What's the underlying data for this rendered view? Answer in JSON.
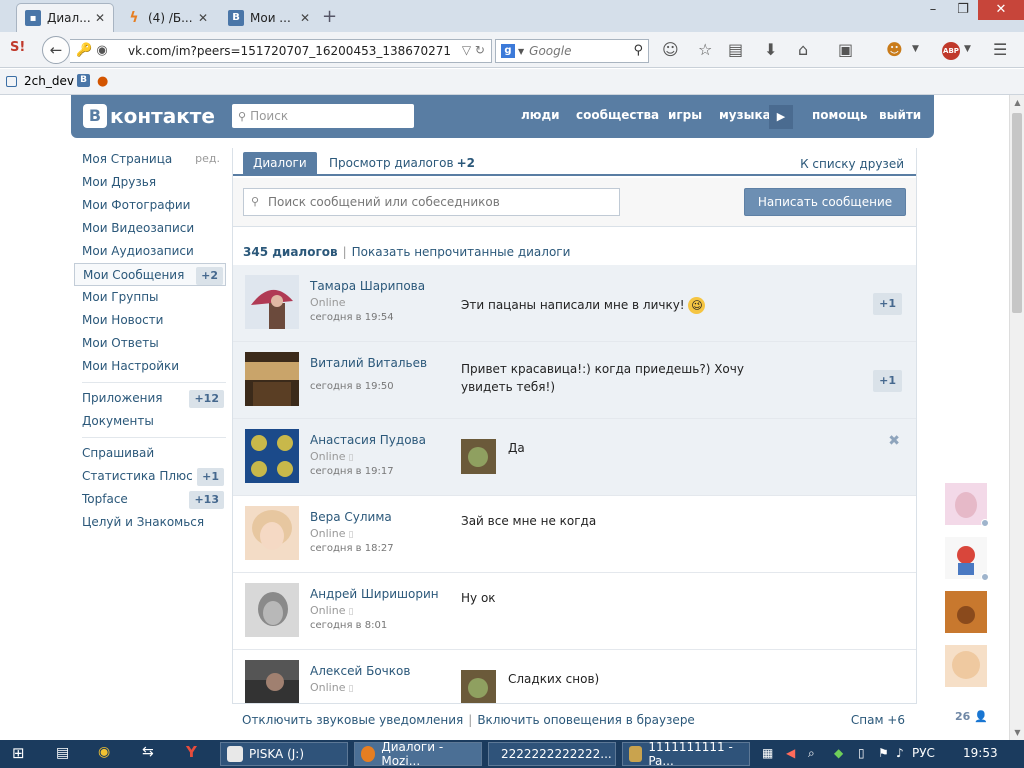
{
  "browser": {
    "tabs": [
      {
        "label": "Диал...",
        "color": "#4a76a8"
      },
      {
        "label": "(4) /Б...",
        "color": "#e67e22"
      },
      {
        "label": "Мои ...",
        "color": "#4a76a8"
      }
    ],
    "new_tab": "+",
    "window_controls": {
      "minimize": "–",
      "restore": "❐",
      "close": "✕"
    },
    "url": "vk.com/im?peers=151720707_16200453_138670271",
    "search_engine": "g",
    "search_placeholder": "Google",
    "bookmarks": [
      {
        "label": "2ch_dev"
      },
      {
        "label": "B"
      }
    ],
    "addon_abp": "ABP"
  },
  "vk": {
    "logo_letter": "B",
    "logo_text": "контакте",
    "search_placeholder": "Поиск",
    "nav": [
      "люди",
      "сообщества",
      "игры",
      "музыка",
      "помощь",
      "выйти"
    ],
    "left_menu": [
      {
        "label": "Моя Страница",
        "extra": "ред."
      },
      {
        "label": "Мои Друзья"
      },
      {
        "label": "Мои Фотографии"
      },
      {
        "label": "Мои Видеозаписи"
      },
      {
        "label": "Мои Аудиозаписи"
      },
      {
        "label": "Мои Сообщения",
        "badge": "+2",
        "active": true
      },
      {
        "label": "Мои Группы"
      },
      {
        "label": "Мои Новости"
      },
      {
        "label": "Мои Ответы"
      },
      {
        "label": "Мои Настройки"
      }
    ],
    "left_menu_apps": [
      {
        "label": "Приложения",
        "badge": "+12"
      },
      {
        "label": "Документы"
      }
    ],
    "left_menu_games": [
      {
        "label": "Спрашивай"
      },
      {
        "label": "Статистика Плюс",
        "badge": "+1"
      },
      {
        "label": "Topface",
        "badge": "+13"
      },
      {
        "label": "Целуй и Знакомься"
      }
    ],
    "tabs": {
      "dialogs": "Диалоги",
      "view": "Просмотр диалогов",
      "view_badge": "+2",
      "friends_link": "К списку друзей"
    },
    "msg_search_placeholder": "Поиск сообщений или собеседников",
    "write_button": "Написать сообщение",
    "count_label": "345 диалогов",
    "show_unread": "Показать непрочитанные диалоги",
    "dialogs": [
      {
        "name": "Тамара Шарипова",
        "status": "Online",
        "phone": false,
        "time": "сегодня в 19:54",
        "message": "Эти пацаны написали мне в личку!",
        "emoji": true,
        "badge": "+1",
        "unread": true,
        "avatar": [
          "#b03a54",
          "#e8c6cf"
        ]
      },
      {
        "name": "Виталий Витальев",
        "status": "",
        "phone": false,
        "time": "сегодня в 19:50",
        "message": "Привет красавица!:) когда приедешь?) Хочу увидеть тебя!)",
        "badge": "+1",
        "unread": true,
        "avatar": [
          "#3b2a1a",
          "#c9a46a"
        ]
      },
      {
        "name": "Анастасия Пудова",
        "status": "Online",
        "phone": true,
        "time": "сегодня в 19:17",
        "message": "Да",
        "mini": true,
        "close": "✖",
        "unread": true,
        "avatar": [
          "#1b4a8a",
          "#c8b84a"
        ]
      },
      {
        "name": "Вера Сулима",
        "status": "Online",
        "phone": true,
        "time": "сегодня в 18:27",
        "message": "Зай все мне не когда",
        "unread": false,
        "avatar": [
          "#e0b48c",
          "#f3dcc6"
        ]
      },
      {
        "name": "Андрей Ширишорин",
        "status": "Online",
        "phone": true,
        "time": "сегодня в 8:01",
        "message": "Ну ок",
        "unread": false,
        "avatar": [
          "#3a3a3a",
          "#d8d8d8"
        ]
      },
      {
        "name": "Алексей Бочков",
        "status": "Online",
        "phone": true,
        "time": "",
        "message": "Сладких снов)",
        "mini": true,
        "unread": false,
        "avatar": [
          "#333",
          "#999"
        ]
      }
    ],
    "bottom": {
      "mute": "Отключить звуковые уведомления",
      "notify": "Включить оповещения в браузере",
      "spam": "Спам +6"
    },
    "friends_count": "26"
  },
  "taskbar": {
    "items": [
      {
        "label": "PISKA (J:)"
      },
      {
        "label": "Диалоги - Mozi..."
      },
      {
        "label": "2222222222222..."
      },
      {
        "label": "1111111111 - Pa..."
      }
    ],
    "lang": "РУС",
    "clock": "19:53"
  }
}
